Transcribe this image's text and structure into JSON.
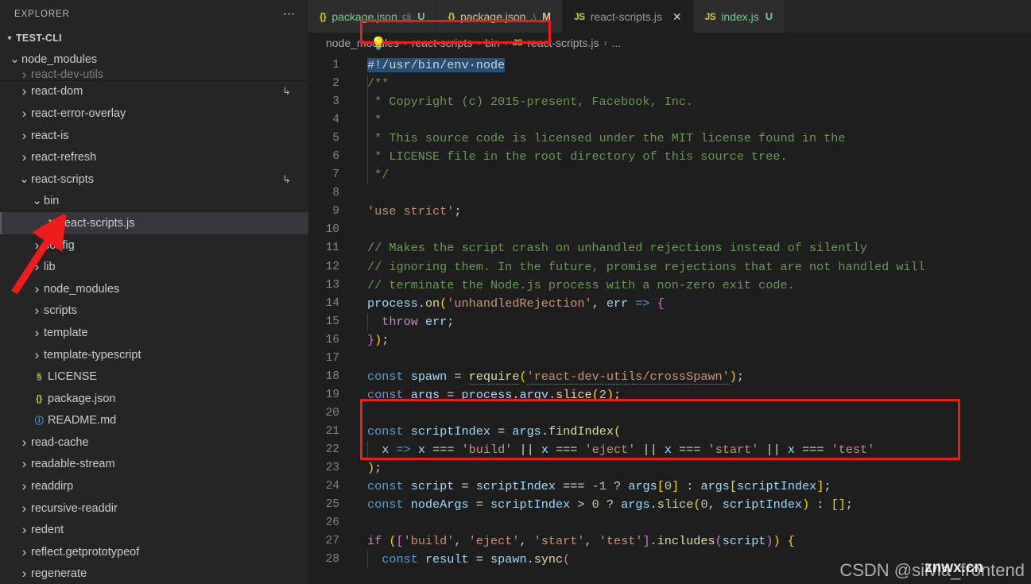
{
  "sidebar": {
    "header_title": "EXPLORER",
    "more_icon": "ellipsis-icon",
    "root_label": "TEST-CLI",
    "items": [
      {
        "label": "node_modules",
        "kind": "folder",
        "state": "expanded",
        "indent": 1
      },
      {
        "label": "react-dev-utils",
        "kind": "folder",
        "state": "collapsed",
        "indent": 2,
        "partial": true
      },
      {
        "label": "react-dom",
        "kind": "folder",
        "state": "collapsed",
        "indent": 2,
        "symlink": true
      },
      {
        "label": "react-error-overlay",
        "kind": "folder",
        "state": "collapsed",
        "indent": 2
      },
      {
        "label": "react-is",
        "kind": "folder",
        "state": "collapsed",
        "indent": 2
      },
      {
        "label": "react-refresh",
        "kind": "folder",
        "state": "collapsed",
        "indent": 2
      },
      {
        "label": "react-scripts",
        "kind": "folder",
        "state": "expanded",
        "indent": 2,
        "symlink": true
      },
      {
        "label": "bin",
        "kind": "folder",
        "state": "expanded",
        "indent": 3
      },
      {
        "label": "react-scripts.js",
        "kind": "file",
        "icon": "JS",
        "icon_class": "ic-js",
        "indent": 4,
        "selected": true
      },
      {
        "label": "config",
        "kind": "folder",
        "state": "collapsed",
        "indent": 3
      },
      {
        "label": "lib",
        "kind": "folder",
        "state": "collapsed",
        "indent": 3
      },
      {
        "label": "node_modules",
        "kind": "folder",
        "state": "collapsed",
        "indent": 3
      },
      {
        "label": "scripts",
        "kind": "folder",
        "state": "collapsed",
        "indent": 3
      },
      {
        "label": "template",
        "kind": "folder",
        "state": "collapsed",
        "indent": 3
      },
      {
        "label": "template-typescript",
        "kind": "folder",
        "state": "collapsed",
        "indent": 3
      },
      {
        "label": "LICENSE",
        "kind": "file",
        "icon": "§",
        "icon_class": "ic-lic",
        "indent": 3
      },
      {
        "label": "package.json",
        "kind": "file",
        "icon": "{}",
        "icon_class": "ic-json",
        "indent": 3
      },
      {
        "label": "README.md",
        "kind": "file",
        "icon": "ⓘ",
        "icon_class": "ic-md",
        "indent": 3
      },
      {
        "label": "read-cache",
        "kind": "folder",
        "state": "collapsed",
        "indent": 2
      },
      {
        "label": "readable-stream",
        "kind": "folder",
        "state": "collapsed",
        "indent": 2
      },
      {
        "label": "readdirp",
        "kind": "folder",
        "state": "collapsed",
        "indent": 2
      },
      {
        "label": "recursive-readdir",
        "kind": "folder",
        "state": "collapsed",
        "indent": 2
      },
      {
        "label": "redent",
        "kind": "folder",
        "state": "collapsed",
        "indent": 2
      },
      {
        "label": "reflect.getprototypeof",
        "kind": "folder",
        "state": "collapsed",
        "indent": 2
      },
      {
        "label": "regenerate",
        "kind": "folder",
        "state": "collapsed",
        "indent": 2
      }
    ]
  },
  "tabs": [
    {
      "icon": "{}",
      "label": "package.json",
      "desc": "cli",
      "badge": "U",
      "name_class": "name-u",
      "badge_class": "badge-u",
      "active": false,
      "closable": false
    },
    {
      "icon": "{}",
      "label": "package.json",
      "desc": ".\\",
      "badge": "M",
      "name_class": "name-m",
      "badge_class": "badge-m",
      "active": false,
      "closable": false
    },
    {
      "icon": "JS",
      "label": "react-scripts.js",
      "desc": "",
      "badge": "",
      "name_class": "name-plain",
      "badge_class": "",
      "active": true,
      "closable": true,
      "close_icon": "✕"
    },
    {
      "icon": "JS",
      "label": "index.js",
      "desc": "",
      "badge": "U",
      "name_class": "name-u",
      "badge_class": "badge-u",
      "active": false,
      "closable": false
    }
  ],
  "breadcrumb": {
    "crumbs": [
      "node_modules",
      "react-scripts",
      "bin",
      "react-scripts.js",
      "..."
    ],
    "file_icon": "JS",
    "separator": "›"
  },
  "editor": {
    "selected_line": 1,
    "lightbulb_icon": "💡",
    "lines": [
      {
        "n": 1,
        "html": "<span class=\"sel\">#!/usr/bin/env&#183;node</span>"
      },
      {
        "n": 2,
        "html": "<span class=\"guide\"></span><span class=\"t-com\">/**</span>"
      },
      {
        "n": 3,
        "html": "<span class=\"guide\"></span><span class=\"t-com\"> * Copyright (c) 2015-present, Facebook, Inc.</span>"
      },
      {
        "n": 4,
        "html": "<span class=\"guide\"></span><span class=\"t-com\"> *</span>"
      },
      {
        "n": 5,
        "html": "<span class=\"guide\"></span><span class=\"t-com\"> * This source code is licensed under the MIT license found in the</span>"
      },
      {
        "n": 6,
        "html": "<span class=\"guide\"></span><span class=\"t-com\"> * LICENSE file in the root directory of this source tree.</span>"
      },
      {
        "n": 7,
        "html": "<span class=\"guide\"></span><span class=\"t-com\"> */</span>"
      },
      {
        "n": 8,
        "html": ""
      },
      {
        "n": 9,
        "html": "<span class=\"t-str\">'use strict'</span><span class=\"t-plain\">;</span>"
      },
      {
        "n": 10,
        "html": ""
      },
      {
        "n": 11,
        "html": "<span class=\"t-com\">// Makes the script crash on unhandled rejections instead of silently</span>"
      },
      {
        "n": 12,
        "html": "<span class=\"t-com\">// ignoring them. In the future, promise rejections that are not handled will</span>"
      },
      {
        "n": 13,
        "html": "<span class=\"t-com\">// terminate the Node.js process with a non-zero exit code.</span>"
      },
      {
        "n": 14,
        "html": "<span class=\"t-var\">process</span><span class=\"t-plain\">.</span><span class=\"t-fn\">on</span><span class=\"t-pa\">(</span><span class=\"t-str\">'unhandledRejection'</span><span class=\"t-plain\">, </span><span class=\"t-var\">err</span> <span class=\"t-kw\">=&gt;</span> <span class=\"t-pb\">{</span>"
      },
      {
        "n": 15,
        "html": "<span class=\"guide\"></span>  <span class=\"t-ctl\">throw</span> <span class=\"t-var\">err</span><span class=\"t-plain\">;</span>"
      },
      {
        "n": 16,
        "html": "<span class=\"t-pb\">}</span><span class=\"t-pa\">)</span><span class=\"t-plain\">;</span>"
      },
      {
        "n": 17,
        "html": ""
      },
      {
        "n": 18,
        "html": "<span class=\"t-kw\">const</span> <span class=\"t-var\">spawn</span> <span class=\"t-plain\">=</span> <span class=\"t-fn squig\">require</span><span class=\"t-pa\">(</span><span class=\"t-str squig\">'react-dev-utils/crossSpawn'</span><span class=\"t-pa\">)</span><span class=\"t-plain\">;</span>"
      },
      {
        "n": 19,
        "html": "<span class=\"t-kw\">const</span> <span class=\"t-var\">args</span> <span class=\"t-plain\">=</span> <span class=\"t-var\">process</span><span class=\"t-plain\">.</span><span class=\"t-var\">argv</span><span class=\"t-plain\">.</span><span class=\"t-fn\">slice</span><span class=\"t-pa\">(</span><span class=\"t-num\">2</span><span class=\"t-pa\">)</span><span class=\"t-plain\">;</span>"
      },
      {
        "n": 20,
        "html": ""
      },
      {
        "n": 21,
        "html": "<span class=\"t-kw\">const</span> <span class=\"t-var\">scriptIndex</span> <span class=\"t-plain\">=</span> <span class=\"t-var\">args</span><span class=\"t-plain\">.</span><span class=\"t-fn\">findIndex</span><span class=\"t-pa\">(</span>"
      },
      {
        "n": 22,
        "html": "<span class=\"guide\"></span>  <span class=\"t-var\">x</span> <span class=\"t-kw\">=&gt;</span> <span class=\"t-var\">x</span> <span class=\"t-plain\">===</span> <span class=\"t-str\">'build'</span> <span class=\"t-plain\">||</span> <span class=\"t-var\">x</span> <span class=\"t-plain\">===</span> <span class=\"t-str\">'eject'</span> <span class=\"t-plain\">||</span> <span class=\"t-var\">x</span> <span class=\"t-plain\">===</span> <span class=\"t-str\">'start'</span> <span class=\"t-plain\">||</span> <span class=\"t-var\">x</span> <span class=\"t-plain\">===</span> <span class=\"t-str\">'test'</span>"
      },
      {
        "n": 23,
        "html": "<span class=\"t-pa\">)</span><span class=\"t-plain\">;</span>"
      },
      {
        "n": 24,
        "html": "<span class=\"t-kw\">const</span> <span class=\"t-var\">script</span> <span class=\"t-plain\">=</span> <span class=\"t-var\">scriptIndex</span> <span class=\"t-plain\">===</span> <span class=\"t-num\">-1</span> <span class=\"t-plain\">?</span> <span class=\"t-var\">args</span><span class=\"t-pa\">[</span><span class=\"t-num\">0</span><span class=\"t-pa\">]</span> <span class=\"t-plain\">:</span> <span class=\"t-var\">args</span><span class=\"t-pa\">[</span><span class=\"t-var\">scriptIndex</span><span class=\"t-pa\">]</span><span class=\"t-plain\">;</span>"
      },
      {
        "n": 25,
        "html": "<span class=\"t-kw\">const</span> <span class=\"t-var\">nodeArgs</span> <span class=\"t-plain\">=</span> <span class=\"t-var\">scriptIndex</span> <span class=\"t-plain\">&gt;</span> <span class=\"t-num\">0</span> <span class=\"t-plain\">?</span> <span class=\"t-var\">args</span><span class=\"t-plain\">.</span><span class=\"t-fn\">slice</span><span class=\"t-pa\">(</span><span class=\"t-num\">0</span><span class=\"t-plain\">, </span><span class=\"t-var\">scriptIndex</span><span class=\"t-pa\">)</span> <span class=\"t-plain\">:</span> <span class=\"t-pa\">[]</span><span class=\"t-plain\">;</span>"
      },
      {
        "n": 26,
        "html": ""
      },
      {
        "n": 27,
        "html": "<span class=\"t-ctl\">if</span> <span class=\"t-pa\">(</span><span class=\"t-pb\">[</span><span class=\"t-str\">'build'</span><span class=\"t-plain\">, </span><span class=\"t-str\">'eject'</span><span class=\"t-plain\">, </span><span class=\"t-str\">'start'</span><span class=\"t-plain\">, </span><span class=\"t-str\">'test'</span><span class=\"t-pb\">]</span><span class=\"t-plain\">.</span><span class=\"t-fn\">includes</span><span class=\"t-pb\">(</span><span class=\"t-var\">script</span><span class=\"t-pb\">)</span><span class=\"t-pa\">)</span> <span class=\"t-pa\">{</span>"
      },
      {
        "n": 28,
        "html": "<span class=\"guide\"></span>  <span class=\"t-kw\">const</span> <span class=\"t-var\">result</span> <span class=\"t-plain\">=</span> <span class=\"t-var\">spawn</span><span class=\"t-plain\">.</span><span class=\"t-fn\">sync</span><span class=\"t-pb\">(</span>"
      }
    ]
  },
  "annotations": {
    "arrow_color": "#ee1c1c",
    "box_color": "#ee1c1c",
    "watermark": "CSDN @silvia_frontend",
    "watermark_overlay": "znwx.cn"
  }
}
